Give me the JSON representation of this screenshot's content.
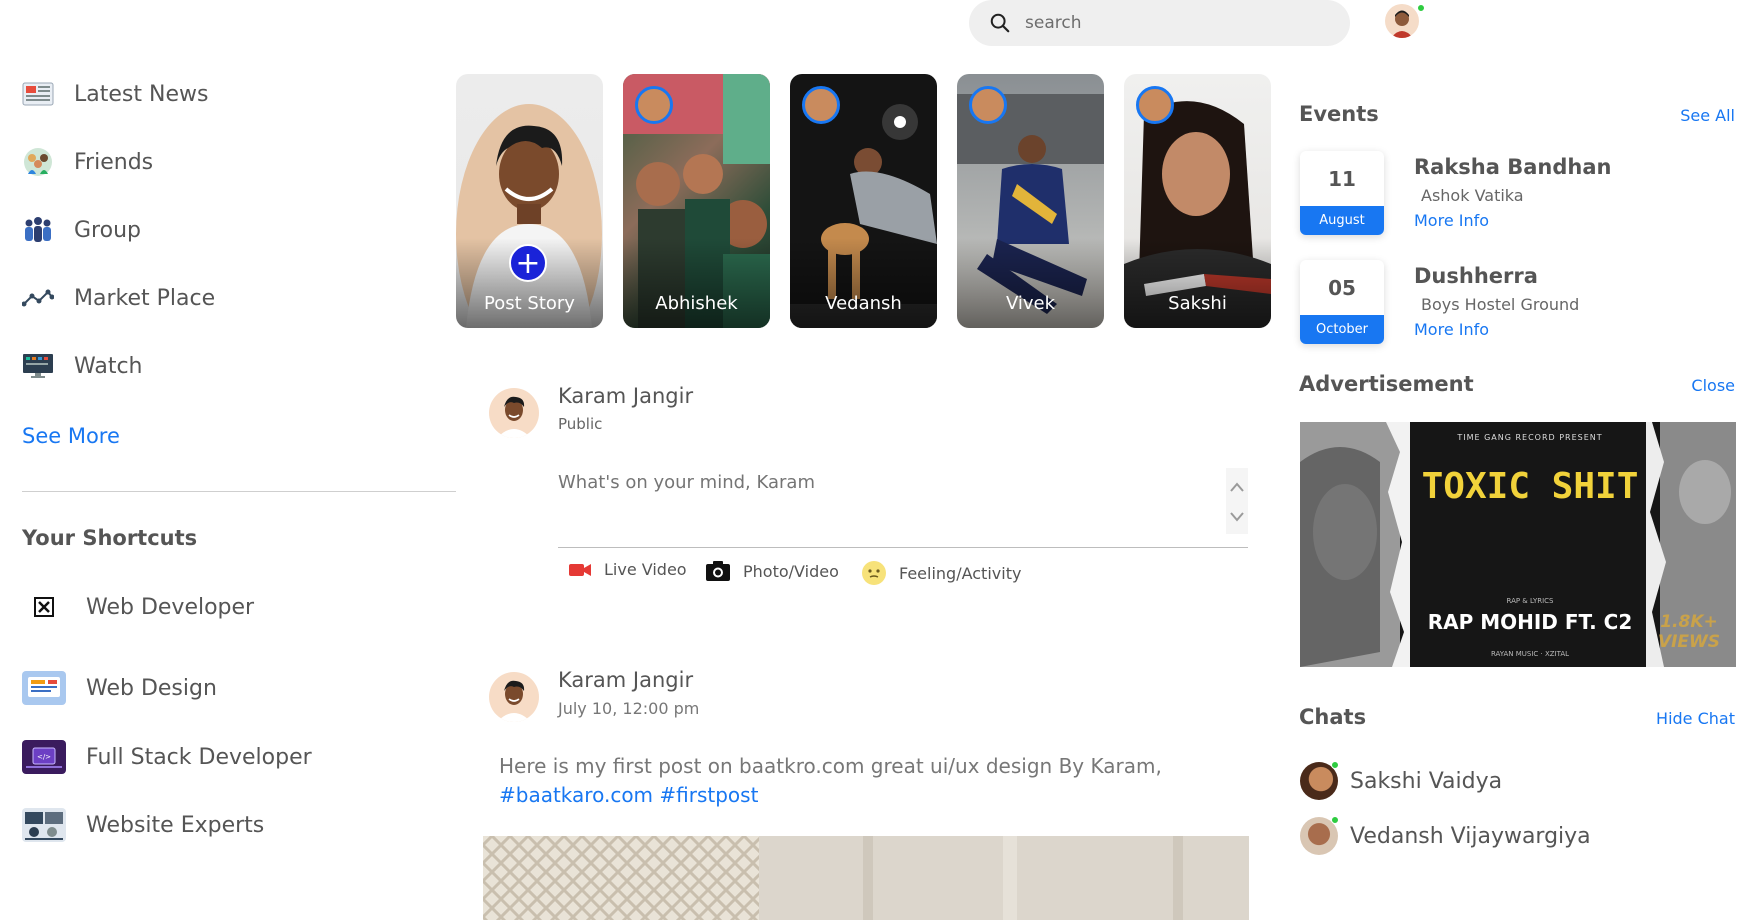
{
  "search": {
    "placeholder": "search"
  },
  "sidebar": {
    "items": [
      {
        "label": "Latest News",
        "icon": "newspaper-icon"
      },
      {
        "label": "Friends",
        "icon": "friends-icon"
      },
      {
        "label": "Group",
        "icon": "group-icon"
      },
      {
        "label": "Market Place",
        "icon": "market-place-icon"
      },
      {
        "label": "Watch",
        "icon": "watch-icon"
      }
    ],
    "see_more": "See More",
    "shortcuts_title": "Your Shortcuts",
    "shortcuts": [
      {
        "label": "Web Developer"
      },
      {
        "label": "Web Design"
      },
      {
        "label": "Full Stack Developer"
      },
      {
        "label": "Website Experts"
      }
    ]
  },
  "stories": [
    {
      "label": "Post Story"
    },
    {
      "label": "Abhishek"
    },
    {
      "label": "Vedansh"
    },
    {
      "label": "Vivek"
    },
    {
      "label": "Sakshi"
    }
  ],
  "composer": {
    "name": "Karam Jangir",
    "visibility": "Public",
    "placeholder": "What's on your mind, Karam",
    "actions": [
      {
        "label": "Live Video",
        "icon": "video-camera-icon"
      },
      {
        "label": "Photo/Video",
        "icon": "camera-icon"
      },
      {
        "label": "Feeling/Activity",
        "icon": "emoji-icon"
      }
    ]
  },
  "post": {
    "author": "Karam Jangir",
    "timestamp": "July 10, 12:00 pm",
    "text": "Here is my first post on baatkro.com great ui/ux design By Karam,",
    "tags": "#baatkaro.com #firstpost"
  },
  "events": {
    "title": "Events",
    "see_all": "See All",
    "items": [
      {
        "day": "11",
        "month": "August",
        "title": "Raksha Bandhan",
        "place": "Ashok Vatika",
        "link": "More Info"
      },
      {
        "day": "05",
        "month": "October",
        "title": "Dushherra",
        "place": "Boys Hostel Ground",
        "link": "More Info"
      }
    ]
  },
  "advertisement": {
    "title": "Advertisement",
    "close": "Close",
    "top_line": "TIME GANG RECORD PRESENT",
    "headline": "TOXIC SHIT",
    "artist": "RAP MOHID FT. C2",
    "credits_top": "RAP & LYRICS",
    "credits_bottom": "RAYAN MUSIC · XZITAL",
    "views": "1.8K+ VIEWS"
  },
  "chats": {
    "title": "Chats",
    "hide": "Hide Chat",
    "items": [
      {
        "name": "Sakshi Vaidya"
      },
      {
        "name": "Vedansh Vijaywargiya"
      }
    ]
  },
  "colors": {
    "accent": "#1877f2",
    "online": "#2ecc40"
  }
}
